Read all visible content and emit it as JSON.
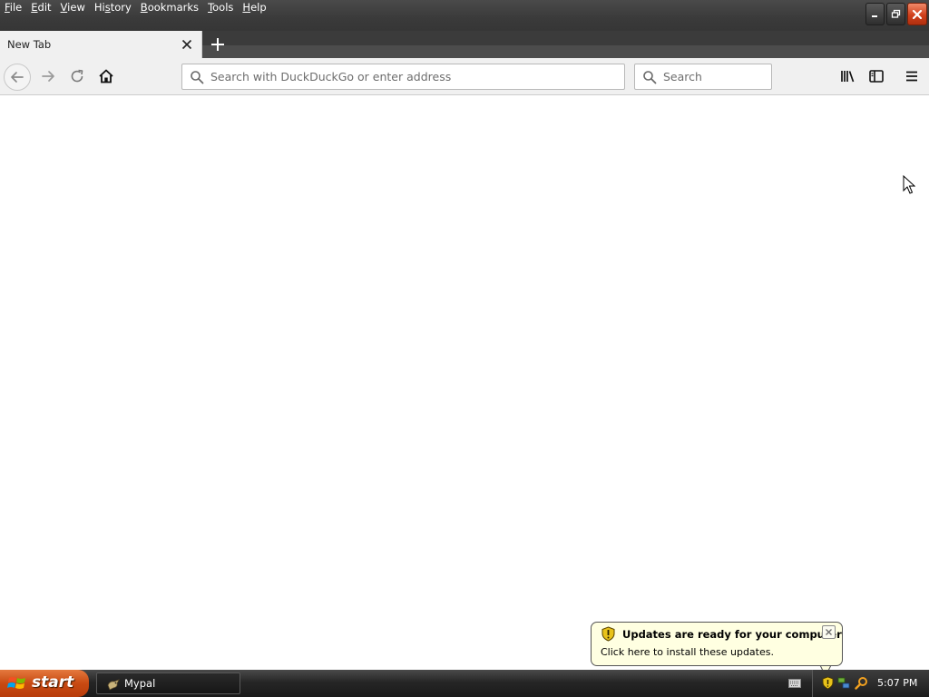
{
  "menubar": {
    "items": [
      {
        "label": "File",
        "mnemonic": "F"
      },
      {
        "label": "Edit",
        "mnemonic": "E"
      },
      {
        "label": "View",
        "mnemonic": "V"
      },
      {
        "label": "History",
        "mnemonic": "s"
      },
      {
        "label": "Bookmarks",
        "mnemonic": "B"
      },
      {
        "label": "Tools",
        "mnemonic": "T"
      },
      {
        "label": "Help",
        "mnemonic": "H"
      }
    ]
  },
  "window_controls": {
    "icons": [
      "minimize-icon",
      "restore-icon",
      "close-icon"
    ],
    "close_color": "#d0401c"
  },
  "tabs": [
    {
      "title": "New Tab",
      "active": true
    }
  ],
  "toolbar": {
    "urlbar": {
      "placeholder": "Search with DuckDuckGo or enter address",
      "value": ""
    },
    "searchbar": {
      "placeholder": "Search",
      "value": ""
    },
    "icons": [
      "back-arrow-icon",
      "forward-arrow-icon",
      "reload-icon",
      "home-icon",
      "library-icon",
      "sidebar-icon",
      "hamburger-menu-icon"
    ]
  },
  "notification": {
    "title": "Updates are ready for your computer",
    "text": "Click here to install these updates.",
    "icon": "security-shield-icon",
    "background": "#ffffe1"
  },
  "taskbar": {
    "start_label": "start",
    "tasks": [
      {
        "label": "Mypal",
        "icon": "mypal-app-icon"
      }
    ],
    "tray": {
      "icons": [
        "keyboard-icon",
        "security-shield-icon",
        "network-icon",
        "search-icon"
      ],
      "clock": "5:07 PM"
    }
  }
}
